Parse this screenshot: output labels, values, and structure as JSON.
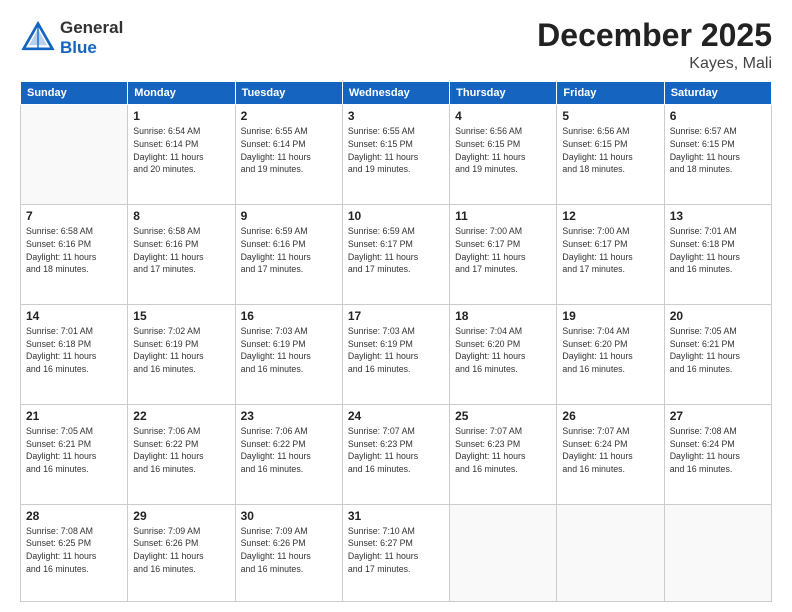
{
  "header": {
    "logo": {
      "general": "General",
      "blue": "Blue"
    },
    "title": "December 2025",
    "location": "Kayes, Mali"
  },
  "days_of_week": [
    "Sunday",
    "Monday",
    "Tuesday",
    "Wednesday",
    "Thursday",
    "Friday",
    "Saturday"
  ],
  "weeks": [
    [
      {
        "day": "",
        "info": ""
      },
      {
        "day": "1",
        "info": "Sunrise: 6:54 AM\nSunset: 6:14 PM\nDaylight: 11 hours\nand 20 minutes."
      },
      {
        "day": "2",
        "info": "Sunrise: 6:55 AM\nSunset: 6:14 PM\nDaylight: 11 hours\nand 19 minutes."
      },
      {
        "day": "3",
        "info": "Sunrise: 6:55 AM\nSunset: 6:15 PM\nDaylight: 11 hours\nand 19 minutes."
      },
      {
        "day": "4",
        "info": "Sunrise: 6:56 AM\nSunset: 6:15 PM\nDaylight: 11 hours\nand 19 minutes."
      },
      {
        "day": "5",
        "info": "Sunrise: 6:56 AM\nSunset: 6:15 PM\nDaylight: 11 hours\nand 18 minutes."
      },
      {
        "day": "6",
        "info": "Sunrise: 6:57 AM\nSunset: 6:15 PM\nDaylight: 11 hours\nand 18 minutes."
      }
    ],
    [
      {
        "day": "7",
        "info": "Sunrise: 6:58 AM\nSunset: 6:16 PM\nDaylight: 11 hours\nand 18 minutes."
      },
      {
        "day": "8",
        "info": "Sunrise: 6:58 AM\nSunset: 6:16 PM\nDaylight: 11 hours\nand 17 minutes."
      },
      {
        "day": "9",
        "info": "Sunrise: 6:59 AM\nSunset: 6:16 PM\nDaylight: 11 hours\nand 17 minutes."
      },
      {
        "day": "10",
        "info": "Sunrise: 6:59 AM\nSunset: 6:17 PM\nDaylight: 11 hours\nand 17 minutes."
      },
      {
        "day": "11",
        "info": "Sunrise: 7:00 AM\nSunset: 6:17 PM\nDaylight: 11 hours\nand 17 minutes."
      },
      {
        "day": "12",
        "info": "Sunrise: 7:00 AM\nSunset: 6:17 PM\nDaylight: 11 hours\nand 17 minutes."
      },
      {
        "day": "13",
        "info": "Sunrise: 7:01 AM\nSunset: 6:18 PM\nDaylight: 11 hours\nand 16 minutes."
      }
    ],
    [
      {
        "day": "14",
        "info": "Sunrise: 7:01 AM\nSunset: 6:18 PM\nDaylight: 11 hours\nand 16 minutes."
      },
      {
        "day": "15",
        "info": "Sunrise: 7:02 AM\nSunset: 6:19 PM\nDaylight: 11 hours\nand 16 minutes."
      },
      {
        "day": "16",
        "info": "Sunrise: 7:03 AM\nSunset: 6:19 PM\nDaylight: 11 hours\nand 16 minutes."
      },
      {
        "day": "17",
        "info": "Sunrise: 7:03 AM\nSunset: 6:19 PM\nDaylight: 11 hours\nand 16 minutes."
      },
      {
        "day": "18",
        "info": "Sunrise: 7:04 AM\nSunset: 6:20 PM\nDaylight: 11 hours\nand 16 minutes."
      },
      {
        "day": "19",
        "info": "Sunrise: 7:04 AM\nSunset: 6:20 PM\nDaylight: 11 hours\nand 16 minutes."
      },
      {
        "day": "20",
        "info": "Sunrise: 7:05 AM\nSunset: 6:21 PM\nDaylight: 11 hours\nand 16 minutes."
      }
    ],
    [
      {
        "day": "21",
        "info": "Sunrise: 7:05 AM\nSunset: 6:21 PM\nDaylight: 11 hours\nand 16 minutes."
      },
      {
        "day": "22",
        "info": "Sunrise: 7:06 AM\nSunset: 6:22 PM\nDaylight: 11 hours\nand 16 minutes."
      },
      {
        "day": "23",
        "info": "Sunrise: 7:06 AM\nSunset: 6:22 PM\nDaylight: 11 hours\nand 16 minutes."
      },
      {
        "day": "24",
        "info": "Sunrise: 7:07 AM\nSunset: 6:23 PM\nDaylight: 11 hours\nand 16 minutes."
      },
      {
        "day": "25",
        "info": "Sunrise: 7:07 AM\nSunset: 6:23 PM\nDaylight: 11 hours\nand 16 minutes."
      },
      {
        "day": "26",
        "info": "Sunrise: 7:07 AM\nSunset: 6:24 PM\nDaylight: 11 hours\nand 16 minutes."
      },
      {
        "day": "27",
        "info": "Sunrise: 7:08 AM\nSunset: 6:24 PM\nDaylight: 11 hours\nand 16 minutes."
      }
    ],
    [
      {
        "day": "28",
        "info": "Sunrise: 7:08 AM\nSunset: 6:25 PM\nDaylight: 11 hours\nand 16 minutes."
      },
      {
        "day": "29",
        "info": "Sunrise: 7:09 AM\nSunset: 6:26 PM\nDaylight: 11 hours\nand 16 minutes."
      },
      {
        "day": "30",
        "info": "Sunrise: 7:09 AM\nSunset: 6:26 PM\nDaylight: 11 hours\nand 16 minutes."
      },
      {
        "day": "31",
        "info": "Sunrise: 7:10 AM\nSunset: 6:27 PM\nDaylight: 11 hours\nand 17 minutes."
      },
      {
        "day": "",
        "info": ""
      },
      {
        "day": "",
        "info": ""
      },
      {
        "day": "",
        "info": ""
      }
    ]
  ]
}
